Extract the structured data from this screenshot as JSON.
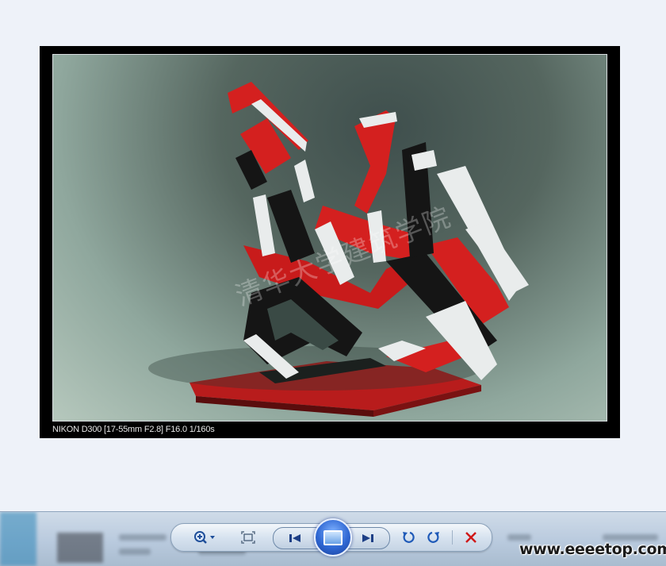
{
  "photo": {
    "caption": "NIKON D300 [17-55mm F2.8] F16.0 1/160s",
    "watermark": "清华大学建筑学院",
    "colors": {
      "sculpture_red": "#d4201f",
      "sculpture_black": "#151515",
      "sculpture_white": "#e9ecec"
    }
  },
  "toolbar": {
    "zoom_icon": "magnifier-plus-icon",
    "fit_icon": "fit-window-icon",
    "previous_icon": "skip-previous-icon",
    "slideshow_icon": "slideshow-icon",
    "next_icon": "skip-next-icon",
    "rotate_ccw_icon": "rotate-counterclockwise-icon",
    "rotate_cw_icon": "rotate-clockwise-icon",
    "delete_icon": "delete-x-icon",
    "accent": "#2f67d3",
    "delete_color": "#d01818"
  },
  "watermark_site": "www.eeeetop.com"
}
